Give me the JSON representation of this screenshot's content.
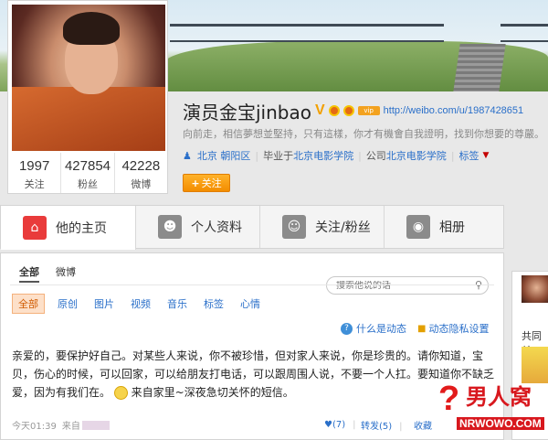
{
  "profile": {
    "name": "演员金宝jinbao",
    "verified_mark": "V",
    "vip_badge": "vip",
    "url": "http://weibo.com/u/1987428651",
    "bio": "向前走，相信夢想並堅持，只有這樣，你才有機會自我證明，找到你想要的尊嚴。",
    "location": "北京 朝阳区",
    "education_prefix": "毕业于",
    "education": "北京电影学院",
    "company_prefix": "公司",
    "company": "北京电影学院",
    "tags_label": "标签",
    "follow_button": "关注",
    "stats": [
      {
        "value": "1997",
        "label": "关注"
      },
      {
        "value": "427854",
        "label": "粉丝"
      },
      {
        "value": "42228",
        "label": "微博"
      }
    ]
  },
  "tabs": [
    {
      "label": "他的主页",
      "icon": "home-icon"
    },
    {
      "label": "个人资料",
      "icon": "person-icon"
    },
    {
      "label": "关注/粉丝",
      "icon": "people-icon"
    },
    {
      "label": "相册",
      "icon": "camera-icon"
    }
  ],
  "feed": {
    "top_tabs": [
      "全部",
      "微博"
    ],
    "search_placeholder": "搜索他说的话",
    "filters": [
      "全部",
      "原创",
      "图片",
      "视频",
      "音乐",
      "标签",
      "心情"
    ],
    "help_link": "什么是动态",
    "privacy_link": "动态隐私设置",
    "post": {
      "text_before_emoji": "亲爱的，要保护好自己。对某些人来说，你不被珍惜，但对家人来说，你是珍贵的。请你知道，宝贝，伤心的时候，可以回家，可以给朋友打电话，可以跟周围人说，不要一个人扛。要知道你不缺乏爱，因为有我们在。",
      "text_after_emoji": "来自家里~深夜急切关怀的短信。",
      "time": "今天01:39",
      "source_prefix": "来自",
      "likes": "(7)",
      "repost": "转发(5)",
      "comment": "收藏"
    }
  },
  "sidebar": {
    "common_label": "共同关"
  },
  "watermark": {
    "mark": "?",
    "text": "男人窝",
    "url": "NRWOWO.COM"
  }
}
